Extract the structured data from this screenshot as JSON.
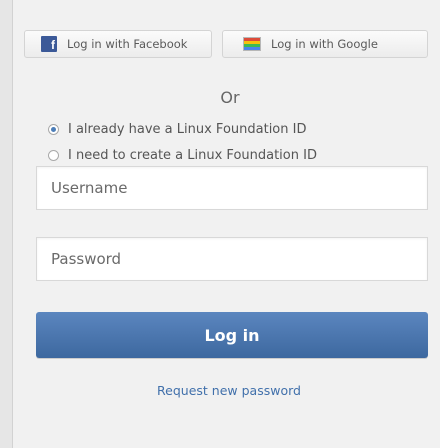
{
  "social": {
    "facebook_label": "Log in with Facebook",
    "google_label": "Log in with Google"
  },
  "divider": {
    "text": "Or"
  },
  "account_options": [
    {
      "label": "I already have a Linux Foundation ID",
      "checked": true
    },
    {
      "label": "I need to create a Linux Foundation ID",
      "checked": false
    }
  ],
  "form": {
    "username_placeholder": "Username",
    "password_placeholder": "Password",
    "login_label": "Log in"
  },
  "links": {
    "request_password": "Request new password"
  },
  "colors": {
    "accent": "#4a76ae",
    "facebook": "#3b5998"
  }
}
